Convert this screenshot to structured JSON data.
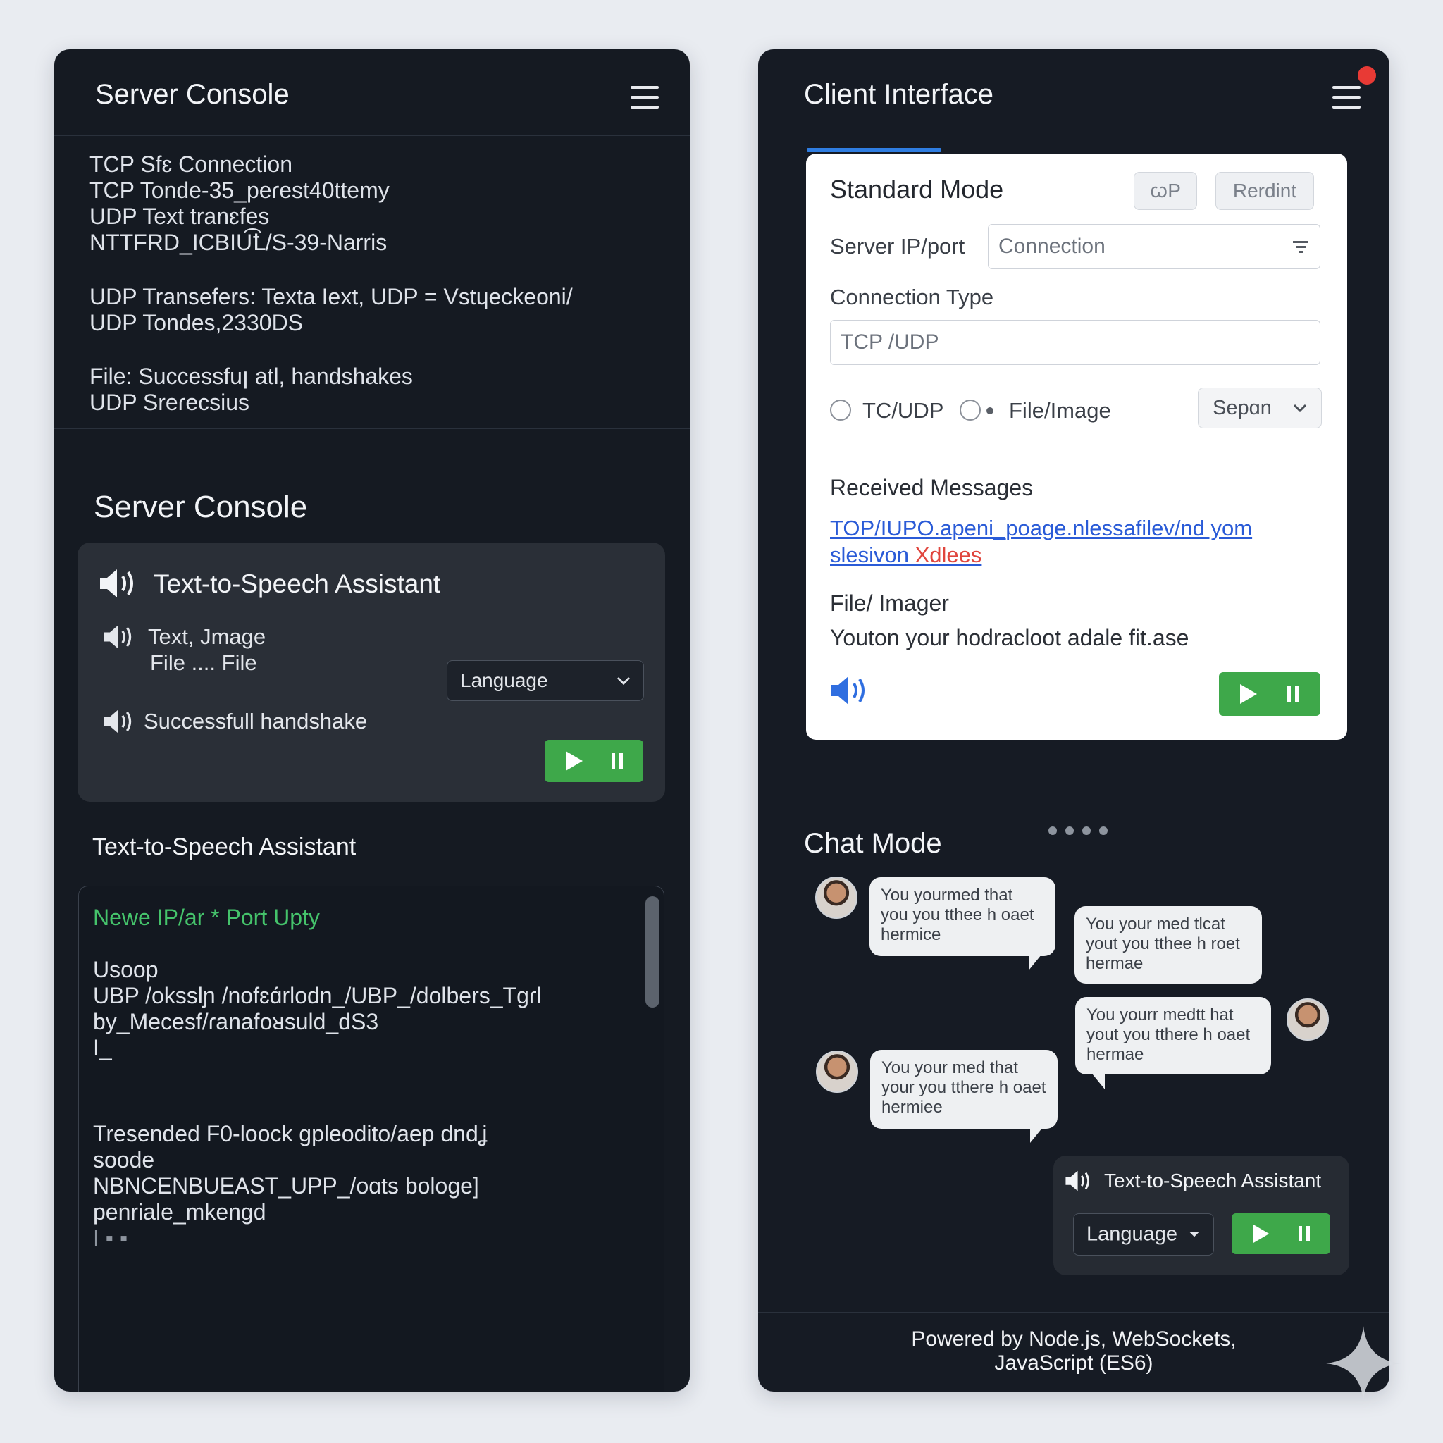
{
  "server": {
    "header_title": "Server Console",
    "log_lines": [
      "TCP Sfɛ Connection",
      "TCP Tonde-35_peɾest40ttemy",
      "UDP Text tranɛfes",
      "NTTFRD_ICBIU͡Ꝉ/S-39-Narris"
    ],
    "transfer_lines": [
      "UDP Transefers:   Texta Iext, UDP = Vstɥeckeoni/",
      "UDP Tondes,2330DS"
    ],
    "file_lines": [
      "File: Successfuꞁ  atl, handshakes",
      "UDP Sreɾecsius"
    ],
    "section_title": "Server Console",
    "tts_card": {
      "title": "Text-to-Speech Assistant",
      "line1": "Text, Jmage",
      "line2": "File .... File",
      "language_label": "Language",
      "line3": "Successfull handshake"
    },
    "tts_title_2": "Text-to-Speech Assistant",
    "terminal": {
      "header_line": "Newe IP/ar * Port Upty",
      "lines_a": [
        "Usoop",
        "UBP /oksslɲ /nofɛɑ́rlodn_/UBP_/dolbers_Tɡɾl",
        "by_Mecesf/ɾanafoᴚsuld_dS3",
        "I_"
      ],
      "lines_b": [
        "Tresended F0-loock gpleodito/aep dndʝ",
        "soode",
        "NBNCENBUEAST_UPP_/oɑts bologe]",
        "penriale_mkengd",
        "I ▪ ▪"
      ]
    }
  },
  "client": {
    "header_title": "Client Interface",
    "standard": {
      "title": "Standard Mode",
      "btn_a": "ꞷP",
      "btn_b": "Rerdint",
      "server_ip_label": "Server IP/port",
      "server_ip_value": "Connection",
      "conn_type_label": "Connection Type",
      "conn_type_value": "TCP /UDP",
      "radio_1": "TC/UDP",
      "radio_2": "File/Image",
      "select_value": "Sepɑn",
      "received_title": "Received Messages",
      "link_line1": "TOP/IUPO.apeni_poage.nlessafilev/nd yom",
      "link_line2_a": "slesivon ",
      "link_line2_b": "Xdlees",
      "file_title": "File/ Imager",
      "file_text": "Youton your hodracloot adale fit.ase"
    },
    "chat": {
      "title": "Chat Mode",
      "bubbles": [
        [
          "You yourmed that",
          "you you tthee h oaet",
          "hermice"
        ],
        [
          "You your med tlcat",
          "yout you tthee h roet",
          "hermae"
        ],
        [
          "You yourr medtt hat",
          "yout you tthere h oaet",
          "hermae"
        ],
        [
          "You your med that",
          "your you tthere h oaet",
          "hermiee"
        ]
      ],
      "tts_title": "Text-to-Speech Assistant",
      "language_label": "Language"
    },
    "footer_line1": "Powered by Node.js, WebSockets,",
    "footer_line2": "JavaScript (ES6)"
  },
  "colors": {
    "panel_bg": "#151a22",
    "accent_green": "#3ea84a",
    "accent_blue": "#2f7de1",
    "link_blue": "#2a5bd7",
    "notif_red": "#e83a35",
    "terminal_green": "#45c36b"
  },
  "icons": [
    "hamburger-icon",
    "speaker-icon",
    "chevron-down-icon",
    "filter-icon",
    "play-icon",
    "pause-icon",
    "sparkle-icon"
  ]
}
